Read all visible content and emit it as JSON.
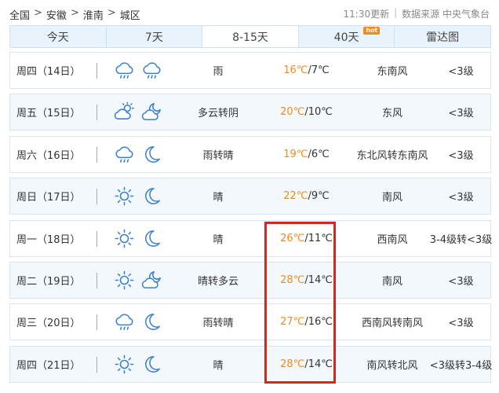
{
  "breadcrumb": {
    "items": [
      "全国",
      "安徽",
      "淮南",
      "城区"
    ],
    "separator": ">"
  },
  "meta": {
    "update": "11:30更新",
    "source": "数据来源 中央气象台"
  },
  "tabs": [
    {
      "label": "今天",
      "badge": ""
    },
    {
      "label": "7天",
      "badge": ""
    },
    {
      "label": "8-15天",
      "badge": "",
      "active": true
    },
    {
      "label": "40天",
      "badge": "hot"
    },
    {
      "label": "雷达图",
      "badge": ""
    }
  ],
  "forecast": [
    {
      "date": "周四（14日）",
      "icons": [
        "rain-cloud-icon",
        "rain-cloud-icon"
      ],
      "desc": "雨",
      "high": "16℃",
      "low": "/7℃",
      "wind": "东南风",
      "level": "<3级"
    },
    {
      "date": "周五（15日）",
      "icons": [
        "partly-cloudy-sun-icon",
        "partly-cloudy-moon-icon"
      ],
      "desc": "多云转阴",
      "high": "20℃",
      "low": "/10℃",
      "wind": "东风",
      "level": "<3级"
    },
    {
      "date": "周六（16日）",
      "icons": [
        "rain-cloud-icon",
        "moon-icon"
      ],
      "desc": "雨转晴",
      "high": "19℃",
      "low": "/6℃",
      "wind": "东北风转东南风",
      "level": "<3级"
    },
    {
      "date": "周日（17日）",
      "icons": [
        "sun-icon",
        "moon-icon"
      ],
      "desc": "晴",
      "high": "22℃",
      "low": "/9℃",
      "wind": "南风",
      "level": "<3级"
    },
    {
      "date": "周一（18日）",
      "icons": [
        "sun-icon",
        "moon-icon"
      ],
      "desc": "晴",
      "high": "26℃",
      "low": "/11℃",
      "wind": "西南风",
      "level": "3-4级转<3级"
    },
    {
      "date": "周二（19日）",
      "icons": [
        "sun-icon",
        "partly-cloudy-moon-icon"
      ],
      "desc": "晴转多云",
      "high": "28℃",
      "low": "/14℃",
      "wind": "南风",
      "level": "<3级"
    },
    {
      "date": "周三（20日）",
      "icons": [
        "rain-cloud-icon",
        "moon-icon"
      ],
      "desc": "雨转晴",
      "high": "27℃",
      "low": "/16℃",
      "wind": "西南风转南风",
      "level": "<3级"
    },
    {
      "date": "周四（21日）",
      "icons": [
        "sun-icon",
        "moon-icon"
      ],
      "desc": "晴",
      "high": "28℃",
      "low": "/14℃",
      "wind": "南风转北风",
      "level": "<3级转3-4级"
    }
  ],
  "colors": {
    "high_temp": "#f08a1c",
    "icon_blue": "#3b7fd0",
    "highlight_box": "#d7261e",
    "tab_bg": "#e9f3fb"
  }
}
